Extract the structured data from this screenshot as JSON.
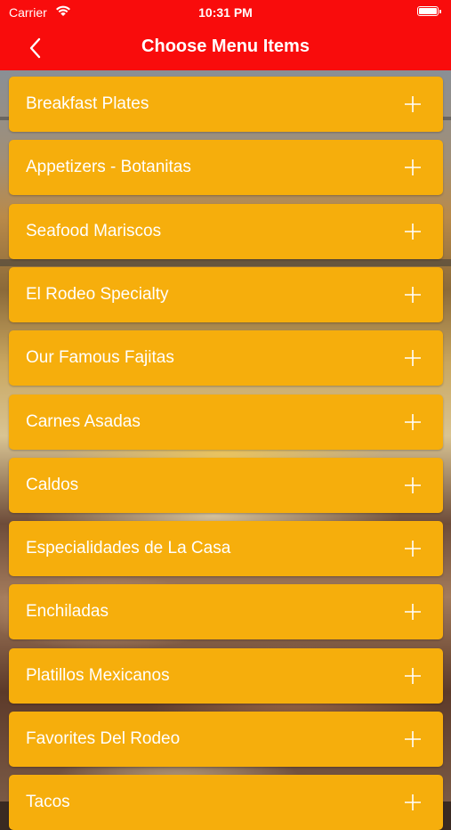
{
  "status_bar": {
    "carrier": "Carrier",
    "time": "10:31 PM",
    "wifi_icon": "wifi-icon",
    "battery_icon": "battery-icon"
  },
  "nav": {
    "title": "Choose Menu Items",
    "back_icon": "chevron-left-icon"
  },
  "colors": {
    "header": "#f90c0c",
    "item_background": "#f6ae0c",
    "item_text": "#ffffff"
  },
  "menu": {
    "expand_icon": "plus-icon",
    "items": [
      {
        "label": "Breakfast Plates"
      },
      {
        "label": "Appetizers - Botanitas"
      },
      {
        "label": "Seafood Mariscos"
      },
      {
        "label": "El Rodeo Specialty"
      },
      {
        "label": "Our Famous Fajitas"
      },
      {
        "label": "Carnes Asadas"
      },
      {
        "label": "Caldos"
      },
      {
        "label": "Especialidades de La Casa"
      },
      {
        "label": "Enchiladas"
      },
      {
        "label": "Platillos Mexicanos"
      },
      {
        "label": "Favorites Del Rodeo"
      },
      {
        "label": "Tacos"
      }
    ]
  }
}
